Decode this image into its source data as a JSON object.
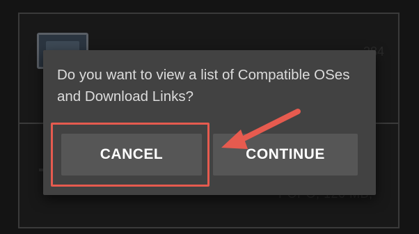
{
  "dialog": {
    "message": "Do you want to view a list of Compatible OSes and Download Links?",
    "cancel_label": "CANCEL",
    "continue_label": "CONTINUE"
  },
  "background": {
    "partial_text_right": "384",
    "partial_text_bottom": "POPO, 120 MB,"
  },
  "annotation": {
    "highlight_color": "#e65b4f",
    "arrow_color": "#e65b4f",
    "highlighted": "cancel-button"
  },
  "colors": {
    "dialog_bg": "#424242",
    "button_bg": "#565656",
    "text": "#dcdcdc"
  }
}
